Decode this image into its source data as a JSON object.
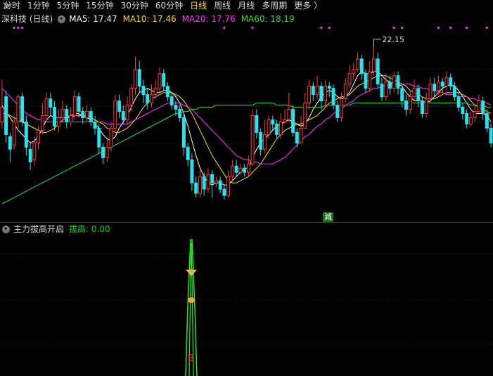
{
  "toolbar": {
    "tabs": [
      "分时",
      "1分钟",
      "5分钟",
      "15分钟",
      "30分钟",
      "60分钟",
      "日线",
      "周线",
      "月线",
      "多周期",
      "更多 〉"
    ],
    "active_index": 6
  },
  "stock": {
    "name": "深科技 (日线)"
  },
  "ma_legend": [
    {
      "text": "MA5: 17.47",
      "color": "#ffffff"
    },
    {
      "text": "MA10: 17.46",
      "color": "#ffdd00"
    },
    {
      "text": "MA20: 17.76",
      "color": "#ff33ff"
    },
    {
      "text": "MA60: 18.19",
      "color": "#33dd33"
    }
  ],
  "price_annotation": "22.15",
  "badge": "減",
  "indicator": {
    "title": "主力拔高开启",
    "value_text": "拔高: 0.00",
    "signal_label": "B"
  },
  "colors": {
    "up": "#ff3b3b",
    "down": "#27e3ee",
    "ma5": "#ffffff",
    "ma10": "#ffdd00",
    "ma20": "#ff33ff",
    "ma60": "#33dd33",
    "indicator": "#22ee22"
  },
  "chart_data": {
    "type": "candlestick",
    "ylim": [
      14.3,
      23.0
    ],
    "candles": [
      [
        18.6,
        19.3,
        20.6,
        18.3
      ],
      [
        19.8,
        18.0,
        20.1,
        17.6
      ],
      [
        17.9,
        17.3,
        18.1,
        16.7
      ],
      [
        17.5,
        18.6,
        18.9,
        17.3
      ],
      [
        18.6,
        19.8,
        19.9,
        18.3
      ],
      [
        19.8,
        18.6,
        20.0,
        18.4
      ],
      [
        18.6,
        17.4,
        18.9,
        17.0
      ],
      [
        17.3,
        16.7,
        17.6,
        16.3
      ],
      [
        16.8,
        17.6,
        17.9,
        16.5
      ],
      [
        17.6,
        18.2,
        18.4,
        17.3
      ],
      [
        18.2,
        18.9,
        19.5,
        18.0
      ],
      [
        18.9,
        19.7,
        20.0,
        18.6
      ],
      [
        19.7,
        19.3,
        20.0,
        18.9
      ],
      [
        19.3,
        18.4,
        19.6,
        18.2
      ],
      [
        18.4,
        18.8,
        19.2,
        18.1
      ],
      [
        18.8,
        19.2,
        19.6,
        18.6
      ],
      [
        19.2,
        18.6,
        19.4,
        18.3
      ],
      [
        18.6,
        18.9,
        19.3,
        18.4
      ],
      [
        18.9,
        19.8,
        20.1,
        18.7
      ],
      [
        19.8,
        19.1,
        20.0,
        18.8
      ],
      [
        19.1,
        18.8,
        19.3,
        18.5
      ],
      [
        18.8,
        19.1,
        19.4,
        18.6
      ],
      [
        19.1,
        18.6,
        19.3,
        18.4
      ],
      [
        18.6,
        18.3,
        18.9,
        18.0
      ],
      [
        18.3,
        17.4,
        18.5,
        17.1
      ],
      [
        17.4,
        16.9,
        17.6,
        16.6
      ],
      [
        16.9,
        17.4,
        17.8,
        16.7
      ],
      [
        17.4,
        18.3,
        18.6,
        17.2
      ],
      [
        18.3,
        19.6,
        19.9,
        18.1
      ],
      [
        19.6,
        19.1,
        19.9,
        18.8
      ],
      [
        19.1,
        18.7,
        19.4,
        18.5
      ],
      [
        18.7,
        19.4,
        19.8,
        18.5
      ],
      [
        19.4,
        20.2,
        20.4,
        19.1
      ],
      [
        20.2,
        21.1,
        21.7,
        19.9
      ],
      [
        21.1,
        20.3,
        21.5,
        20.0
      ],
      [
        20.3,
        19.9,
        20.6,
        19.5
      ],
      [
        19.9,
        19.5,
        20.2,
        19.2
      ],
      [
        19.5,
        19.9,
        20.4,
        19.3
      ],
      [
        19.9,
        20.2,
        20.6,
        19.7
      ],
      [
        20.2,
        20.9,
        21.2,
        20.0
      ],
      [
        20.9,
        20.3,
        21.1,
        20.1
      ],
      [
        20.3,
        19.8,
        20.5,
        19.6
      ],
      [
        19.8,
        19.4,
        20.0,
        19.2
      ],
      [
        19.4,
        19.2,
        19.6,
        18.9
      ],
      [
        19.2,
        18.8,
        19.4,
        18.6
      ],
      [
        18.8,
        17.4,
        19.0,
        17.0
      ],
      [
        17.4,
        16.8,
        17.6,
        16.5
      ],
      [
        16.8,
        15.7,
        17.1,
        15.3
      ],
      [
        15.7,
        15.2,
        16.0,
        15.0
      ],
      [
        15.2,
        16.0,
        16.3,
        15.0
      ],
      [
        16.0,
        15.4,
        16.2,
        15.1
      ],
      [
        15.4,
        16.1,
        16.4,
        15.2
      ],
      [
        16.1,
        15.7,
        16.3,
        15.0
      ],
      [
        15.7,
        15.8,
        16.0,
        15.5
      ],
      [
        15.8,
        15.4,
        16.0,
        15.2
      ],
      [
        15.4,
        15.1,
        15.6,
        14.9
      ],
      [
        15.1,
        16.0,
        16.3,
        15.0
      ],
      [
        16.0,
        16.5,
        16.8,
        15.8
      ],
      [
        16.5,
        16.2,
        16.8,
        16.0
      ],
      [
        16.2,
        16.4,
        16.6,
        16.1
      ],
      [
        16.4,
        16.2,
        16.6,
        16.0
      ],
      [
        16.2,
        16.6,
        17.0,
        16.0
      ],
      [
        16.6,
        18.9,
        19.2,
        16.5
      ],
      [
        18.9,
        18.1,
        19.2,
        17.8
      ],
      [
        18.1,
        17.3,
        18.3,
        17.0
      ],
      [
        17.3,
        18.0,
        18.7,
        17.1
      ],
      [
        18.0,
        18.7,
        18.9,
        17.8
      ],
      [
        18.7,
        18.5,
        18.9,
        18.2
      ],
      [
        18.5,
        18.0,
        18.7,
        17.8
      ],
      [
        18.0,
        18.6,
        19.0,
        17.8
      ],
      [
        18.6,
        18.7,
        19.2,
        18.5
      ],
      [
        18.7,
        19.2,
        20.0,
        18.6
      ],
      [
        19.2,
        18.1,
        19.4,
        17.9
      ],
      [
        18.1,
        17.6,
        18.3,
        17.4
      ],
      [
        17.6,
        18.3,
        18.9,
        17.6
      ],
      [
        18.3,
        19.5,
        20.0,
        18.3
      ],
      [
        19.5,
        20.3,
        20.6,
        19.2
      ],
      [
        20.3,
        19.9,
        20.5,
        19.6
      ],
      [
        19.9,
        20.3,
        20.8,
        19.7
      ],
      [
        20.3,
        19.6,
        20.5,
        19.2
      ],
      [
        19.6,
        20.3,
        20.6,
        19.3
      ],
      [
        20.3,
        20.2,
        20.5,
        19.8
      ],
      [
        20.2,
        19.4,
        20.4,
        19.2
      ],
      [
        19.4,
        18.8,
        19.6,
        18.6
      ],
      [
        18.8,
        19.7,
        20.0,
        18.6
      ],
      [
        19.7,
        20.4,
        20.7,
        19.5
      ],
      [
        20.4,
        20.9,
        21.3,
        20.2
      ],
      [
        20.9,
        21.1,
        21.4,
        20.6
      ],
      [
        21.1,
        21.6,
        21.9,
        21.0
      ],
      [
        21.6,
        20.9,
        21.8,
        20.6
      ],
      [
        20.9,
        20.2,
        21.1,
        20.0
      ],
      [
        20.2,
        21.0,
        21.5,
        20.0
      ],
      [
        21.0,
        21.6,
        22.2,
        20.8
      ],
      [
        21.6,
        20.4,
        21.9,
        20.2
      ],
      [
        20.4,
        19.8,
        20.7,
        19.6
      ],
      [
        19.8,
        20.5,
        20.9,
        19.6
      ],
      [
        20.5,
        20.2,
        20.8,
        19.9
      ],
      [
        20.2,
        20.8,
        21.0,
        20.0
      ],
      [
        20.8,
        20.2,
        21.0,
        19.9
      ],
      [
        20.2,
        19.6,
        20.4,
        19.3
      ],
      [
        19.6,
        19.2,
        19.9,
        18.9
      ],
      [
        19.2,
        19.8,
        20.1,
        19.0
      ],
      [
        19.8,
        20.2,
        20.6,
        19.6
      ],
      [
        20.2,
        19.6,
        20.4,
        19.3
      ],
      [
        19.6,
        19.0,
        19.8,
        18.8
      ],
      [
        19.0,
        19.7,
        20.0,
        18.8
      ],
      [
        19.7,
        20.4,
        20.7,
        19.5
      ],
      [
        20.4,
        20.1,
        20.7,
        19.8
      ],
      [
        20.1,
        20.5,
        20.8,
        19.9
      ],
      [
        20.5,
        20.3,
        20.7,
        20.0
      ],
      [
        20.3,
        20.7,
        21.0,
        20.1
      ],
      [
        20.7,
        20.3,
        20.9,
        20.1
      ],
      [
        20.3,
        19.8,
        20.5,
        19.6
      ],
      [
        19.8,
        19.3,
        20.0,
        19.1
      ],
      [
        19.3,
        19.0,
        19.5,
        18.7
      ],
      [
        19.0,
        18.5,
        19.2,
        18.3
      ],
      [
        18.5,
        18.8,
        19.1,
        18.4
      ],
      [
        18.8,
        19.1,
        19.4,
        18.6
      ],
      [
        19.1,
        19.6,
        19.9,
        19.0
      ],
      [
        19.6,
        19.0,
        19.8,
        18.7
      ],
      [
        19.0,
        18.3,
        19.2,
        18.1
      ],
      [
        18.3,
        17.6,
        18.5,
        17.4
      ]
    ],
    "ma_values": {
      "ma5": [
        19.4,
        19.1,
        18.8,
        18.5,
        18.2,
        18.0,
        17.8,
        17.6,
        17.7,
        17.9,
        18.3,
        18.7,
        18.9,
        18.8,
        18.8,
        18.8,
        18.8,
        18.9,
        19.0,
        19.0,
        18.9,
        18.8,
        18.7,
        18.5,
        18.3,
        18.0,
        17.8,
        17.7,
        17.9,
        18.3,
        18.6,
        18.9,
        19.3,
        19.7,
        20.0,
        20.1,
        20.2,
        20.1,
        20.0,
        20.0,
        20.1,
        20.1,
        20.0,
        19.8,
        19.5,
        19.0,
        18.4,
        17.7,
        17.0,
        16.4,
        16.0,
        15.7,
        15.6,
        15.7,
        15.7,
        15.6,
        15.6,
        15.8,
        16.0,
        16.2,
        16.4,
        16.4,
        16.9,
        17.3,
        17.6,
        17.8,
        18.0,
        18.2,
        18.4,
        18.5,
        18.6,
        18.7,
        18.6,
        18.5,
        18.4,
        18.5,
        18.8,
        19.2,
        19.5,
        19.8,
        20.0,
        20.1,
        20.0,
        19.8,
        19.7,
        19.8,
        20.0,
        20.4,
        20.8,
        21.0,
        20.9,
        20.9,
        21.0,
        21.0,
        20.8,
        20.6,
        20.5,
        20.4,
        20.4,
        20.3,
        20.0,
        19.8,
        19.6,
        19.6,
        19.6,
        19.5,
        19.6,
        19.8,
        20.0,
        20.2,
        20.3,
        20.4,
        20.3,
        20.1,
        19.8,
        19.5,
        19.2,
        19.0,
        19.0,
        19.0,
        18.9,
        18.6
      ],
      "ma10": [
        19.0,
        19.0,
        18.9,
        18.8,
        18.7,
        18.6,
        18.5,
        18.4,
        18.3,
        18.2,
        18.1,
        18.1,
        18.2,
        18.3,
        18.5,
        18.7,
        18.8,
        18.8,
        18.9,
        18.9,
        18.9,
        18.9,
        18.8,
        18.7,
        18.6,
        18.5,
        18.3,
        18.2,
        18.1,
        18.1,
        18.2,
        18.3,
        18.5,
        18.7,
        19.0,
        19.3,
        19.5,
        19.7,
        19.8,
        19.9,
        20.0,
        20.0,
        20.0,
        19.9,
        19.8,
        19.6,
        19.3,
        19.0,
        18.6,
        18.2,
        17.8,
        17.4,
        17.0,
        16.7,
        16.4,
        16.1,
        15.8,
        15.7,
        15.7,
        15.8,
        15.9,
        16.0,
        16.2,
        16.4,
        16.6,
        16.9,
        17.2,
        17.5,
        17.8,
        18.0,
        18.2,
        18.3,
        18.4,
        18.5,
        18.5,
        18.6,
        18.7,
        18.8,
        18.9,
        19.1,
        19.3,
        19.5,
        19.6,
        19.7,
        19.8,
        19.8,
        19.9,
        20.1,
        20.3,
        20.4,
        20.5,
        20.6,
        20.7,
        20.8,
        20.8,
        20.8,
        20.7,
        20.6,
        20.5,
        20.4,
        20.3,
        20.1,
        20.0,
        19.9,
        19.8,
        19.7,
        19.7,
        19.7,
        19.8,
        19.9,
        20.0,
        20.0,
        20.0,
        20.0,
        19.9,
        19.8,
        19.6,
        19.4,
        19.3,
        19.2,
        19.1,
        19.0
      ],
      "ma20": [
        20.2,
        20.0,
        19.8,
        19.6,
        19.4,
        19.2,
        19.0,
        18.9,
        18.8,
        18.7,
        18.7,
        18.6,
        18.6,
        18.6,
        18.6,
        18.6,
        18.6,
        18.6,
        18.6,
        18.6,
        18.6,
        18.6,
        18.6,
        18.6,
        18.6,
        18.6,
        18.5,
        18.5,
        18.5,
        18.5,
        18.5,
        18.5,
        18.6,
        18.7,
        18.8,
        18.9,
        19.0,
        19.1,
        19.2,
        19.3,
        19.4,
        19.5,
        19.5,
        19.5,
        19.5,
        19.4,
        19.3,
        19.2,
        19.0,
        18.8,
        18.6,
        18.4,
        18.2,
        18.0,
        17.8,
        17.6,
        17.4,
        17.2,
        17.0,
        16.9,
        16.8,
        16.8,
        16.7,
        16.7,
        16.6,
        16.6,
        16.6,
        16.6,
        16.7,
        16.8,
        16.9,
        17.1,
        17.3,
        17.5,
        17.7,
        17.9,
        18.0,
        18.2,
        18.4,
        18.5,
        18.7,
        18.8,
        19.0,
        19.1,
        19.2,
        19.4,
        19.5,
        19.6,
        19.8,
        19.9,
        20.0,
        20.1,
        20.2,
        20.2,
        20.3,
        20.3,
        20.4,
        20.4,
        20.4,
        20.4,
        20.4,
        20.4,
        20.3,
        20.3,
        20.2,
        20.2,
        20.1,
        20.1,
        20.0,
        20.0,
        19.9,
        19.9,
        19.9,
        19.8,
        19.8,
        19.8,
        19.7,
        19.7,
        19.6,
        19.6,
        19.5,
        19.4
      ],
      "ma60": [
        14.7,
        14.8,
        14.9,
        15.0,
        15.1,
        15.2,
        15.3,
        15.4,
        15.5,
        15.6,
        15.7,
        15.8,
        15.9,
        16.0,
        16.1,
        16.2,
        16.3,
        16.4,
        16.5,
        16.6,
        16.7,
        16.8,
        16.9,
        17.0,
        17.1,
        17.2,
        17.3,
        17.4,
        17.5,
        17.6,
        17.7,
        17.8,
        17.9,
        18.0,
        18.1,
        18.2,
        18.3,
        18.4,
        18.5,
        18.6,
        18.7,
        18.8,
        18.9,
        19.0,
        19.0,
        19.1,
        19.1,
        19.2,
        19.2,
        19.3,
        19.3,
        19.3,
        19.3,
        19.4,
        19.4,
        19.4,
        19.4,
        19.4,
        19.4,
        19.4,
        19.4,
        19.4,
        19.4,
        19.5,
        19.5,
        19.5,
        19.5,
        19.5,
        19.4,
        19.4,
        19.4,
        19.4,
        19.3,
        19.3,
        19.3,
        19.3,
        19.3,
        19.3,
        19.3,
        19.3,
        19.4,
        19.4,
        19.4,
        19.4,
        19.4,
        19.4,
        19.4,
        19.5,
        19.5,
        19.5,
        19.5,
        19.5,
        19.5,
        19.5,
        19.5,
        19.5,
        19.5,
        19.5,
        19.5,
        19.5,
        19.5,
        19.5,
        19.5,
        19.5,
        19.5,
        19.5,
        19.5,
        19.5,
        19.5,
        19.5,
        19.5,
        19.5,
        19.5,
        19.5,
        19.5,
        19.5,
        19.4,
        19.4,
        19.4,
        19.4,
        19.3,
        19.3
      ]
    }
  }
}
